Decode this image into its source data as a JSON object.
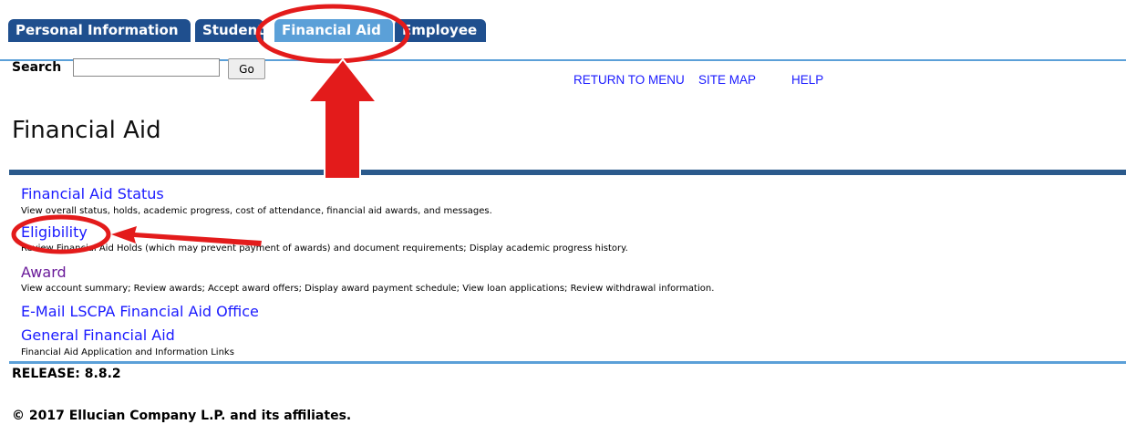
{
  "tabs": [
    {
      "label": "Personal Information"
    },
    {
      "label": "Student"
    },
    {
      "label": "Financial Aid"
    },
    {
      "label": "Employee"
    }
  ],
  "search": {
    "label": "Search",
    "value": "",
    "button": "Go"
  },
  "topnav": {
    "return_to_menu": "RETURN TO MENU",
    "site_map": "SITE MAP",
    "help": "HELP"
  },
  "page": {
    "title": "Financial Aid"
  },
  "menu": [
    {
      "label": "Financial Aid Status",
      "description": "View overall status, holds, academic progress, cost of attendance, financial aid awards, and messages."
    },
    {
      "label": "Eligibility",
      "description": "Review Financial Aid Holds (which may prevent payment of awards) and document requirements; Display academic progress history."
    },
    {
      "label": "Award",
      "description": "View account summary; Review awards; Accept award offers; Display award payment schedule; View loan applications; Review withdrawal information."
    },
    {
      "label": "E-Mail LSCPA Financial Aid Office",
      "description": ""
    },
    {
      "label": "General Financial Aid",
      "description": "Financial Aid Application and Information Links"
    }
  ],
  "footer": {
    "release": "RELEASE: 8.8.2",
    "copyright": "© 2017 Ellucian Company L.P. and its affiliates."
  },
  "colors": {
    "tab": "#1f4f8e",
    "tab_active": "#5ba0d8",
    "link": "#1a1aff",
    "visited": "#6a1b9a",
    "annotation": "#e31b1b"
  }
}
